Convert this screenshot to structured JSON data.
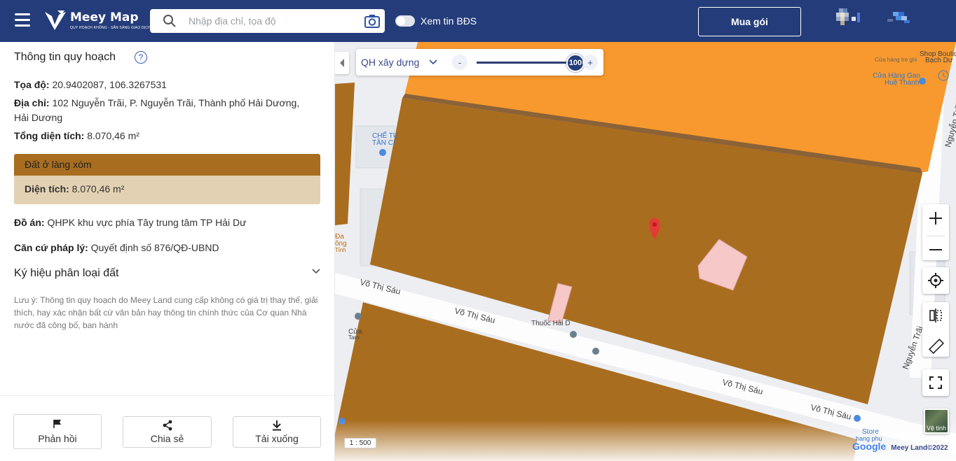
{
  "header": {
    "logo_name": "Meey Map",
    "logo_tagline": "QUY HOẠCH KHÔNG - SẴN SÀNG GIAO DỊCH",
    "search_placeholder": "Nhập địa chỉ, tọa độ",
    "toggle_label": "Xem tin BĐS",
    "buy_button": "Mua gói",
    "icons": [
      "menu-icon",
      "search-icon",
      "camera-icon"
    ]
  },
  "sidebar": {
    "title": "Thông tin quy hoạch",
    "coord_label": "Tọa độ:",
    "coord_value": "20.9402087, 106.3267531",
    "address_label": "Địa chỉ:",
    "address_value": "102 Nguyễn Trãi, P. Nguyễn Trãi, Thành phố Hải Dương,",
    "address_value_2": "Hải Dương",
    "area_label": "Tổng diện tích:",
    "area_value": "8.070,46 m²",
    "land_type": "Đất ở làng xóm",
    "land_area_label": "Diện tích:",
    "land_area_value": "8.070,46 m²",
    "project_label": "Đồ án:",
    "project_value": "QHPK khu vực phía Tây trung tâm TP Hải Dư",
    "legal_label": "Căn cứ pháp lý:",
    "legal_value": "Quyết định số 876/QĐ-UBND",
    "legend_heading": "Ký hiệu phân loại đất",
    "note": "Lưu ý: Thông tin quy hoạch do Meey Land cung cấp không có giá trị thay thế, giải thích, hay xác nhận bất cứ văn bản hay thông tin chính thức của Cơ quan Nhà nước đã công bố, ban hành",
    "footer": {
      "feedback": "Phản hồi",
      "share": "Chia sẻ",
      "download": "Tải xuống"
    }
  },
  "map": {
    "layer_select": "QH xây dựng",
    "opacity_minus": "-",
    "opacity_plus": "+",
    "opacity_value": 100,
    "scale": "1 : 500",
    "satellite_label": "Vệ tinh",
    "attribution_google": "Google",
    "attribution_meey": "Meey Land©2022",
    "labels": {
      "road_vts_1": "Võ Thị Sáu",
      "road_vts_2": "Võ Thị Sáu",
      "road_vts_3": "Võ Thị Sáu",
      "road_vts_4": "Võ Thị Sáu",
      "road_nt_1": "Nguyễn Trãi",
      "road_nt_2": "Nguyễn Trãi",
      "poi_shop_1": "Shop Boutiq",
      "poi_shop_2": "Bạch Dư",
      "poi_shop_3": "Cửa hàng tre ghi",
      "poi_gao_1": "Cửa Hàng Gao",
      "poi_gao_2": "Huệ Thanh",
      "poi_che_1": "CHẾ TU",
      "poi_che_2": "TÂN CI",
      "poi_thuoc": "Thuốc Hải D",
      "poi_cua": "Cửa",
      "poi_tam": "Tam",
      "poi_da": "Đa",
      "poi_dong": "ông",
      "poi_tinh": "Tỉnh",
      "poi_store": "Store",
      "poi_hang": "hang phụ"
    },
    "colors": {
      "land_brown": "#a96d1f",
      "land_orange": "#f7992e",
      "highlight_pink": "#f6c8c8"
    }
  }
}
